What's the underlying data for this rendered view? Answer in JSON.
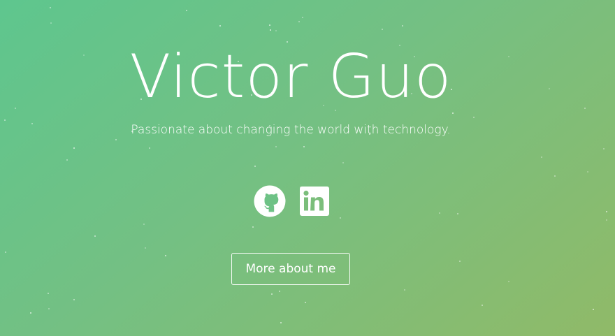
{
  "hero": {
    "name": "Victor Guo",
    "tagline": "Passionate about changing the world with technology.",
    "more_button_label": "More about me",
    "colors": {
      "gradient_start": "#5ec68e",
      "gradient_end": "#90ba68",
      "text": "#ffffff"
    }
  },
  "social_links": [
    {
      "icon": "github-icon"
    },
    {
      "icon": "linkedin-icon"
    }
  ]
}
